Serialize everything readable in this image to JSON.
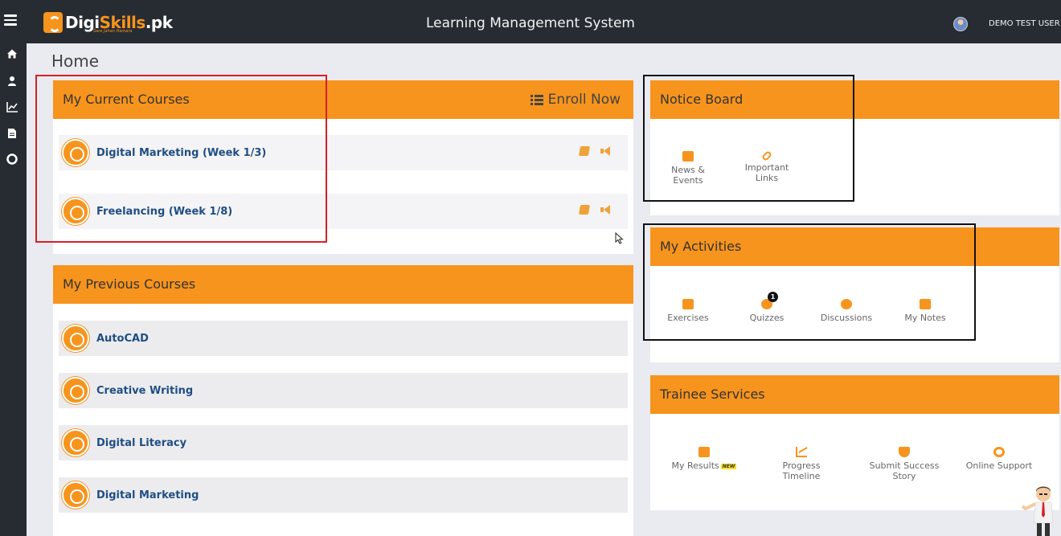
{
  "header": {
    "logo_text": "Digi",
    "logo_text_accent": "Skills",
    "logo_suffix": ".pk",
    "logo_tagline": "Sare Jahan Hamara",
    "title": "Learning Management System",
    "user_name": "DEMO TEST USER"
  },
  "sidebar": {
    "icons": [
      "menu-icon",
      "home-icon",
      "user-icon",
      "chart-icon",
      "document-icon",
      "lifebuoy-icon"
    ]
  },
  "page": {
    "title": "Home"
  },
  "current_courses": {
    "heading": "My Current Courses",
    "enroll_label": "Enroll Now",
    "items": [
      {
        "name": "Digital Marketing (Week 1/3)"
      },
      {
        "name": "Freelancing (Week 1/8)"
      }
    ]
  },
  "previous_courses": {
    "heading": "My Previous Courses",
    "items": [
      {
        "name": "AutoCAD"
      },
      {
        "name": "Creative Writing"
      },
      {
        "name": "Digital Literacy"
      },
      {
        "name": "Digital Marketing"
      }
    ]
  },
  "notice_board": {
    "heading": "Notice Board",
    "tiles": [
      {
        "label": "News & Events",
        "icon": "easel-icon"
      },
      {
        "label": "Important Links",
        "icon": "link-icon"
      }
    ]
  },
  "activities": {
    "heading": "My Activities",
    "tiles": [
      {
        "label": "Exercises",
        "icon": "credit-card-icon"
      },
      {
        "label": "Quizzes",
        "icon": "question-icon",
        "badge": "1"
      },
      {
        "label": "Discussions",
        "icon": "comments-icon"
      },
      {
        "label": "My Notes",
        "icon": "note-icon"
      }
    ]
  },
  "trainee_services": {
    "heading": "Trainee Services",
    "tiles": [
      {
        "label": "My Results",
        "icon": "results-icon",
        "badge": "NEW"
      },
      {
        "label": "Progress Timeline",
        "icon": "line-chart-icon"
      },
      {
        "label": "Submit Success Story",
        "icon": "trophy-icon"
      },
      {
        "label": "Online Support",
        "icon": "lifebuoy-icon"
      }
    ]
  },
  "colors": {
    "accent": "#f7941d",
    "topbar": "#272c33",
    "link": "#1f4e84",
    "annotation_red": "#d62027",
    "annotation_black": "#111111"
  }
}
